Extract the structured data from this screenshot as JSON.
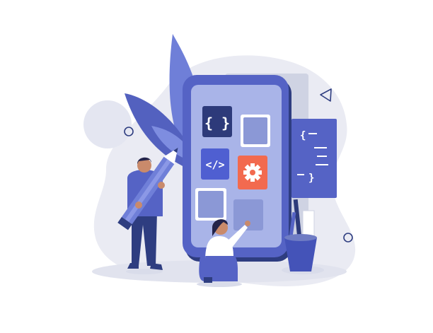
{
  "palette": {
    "blob": "#eaebf3",
    "blob_dark": "#e1e3ee",
    "navy": "#2e3d80",
    "phone_blue": "#5563c5",
    "screen": "#a9b4e8",
    "tile": "#8b98d6",
    "tile_edge": "#6f7cc4",
    "dark_tile": "#2d3a7a",
    "accent_red": "#f26a4f",
    "leaf": "#6f7fd8",
    "leaf_dark": "#5361bf",
    "skin": "#c98a6b",
    "hair": "#23234a"
  },
  "icons": {
    "braces_tile": "curly-braces",
    "code_tile": "code-tag",
    "settings_tile": "gear",
    "doc_card": "code-document"
  },
  "glyphs": {
    "braces": "{ }",
    "code": "</>",
    "doc_open": "{",
    "doc_close": "}",
    "doc_dash_top": "—",
    "doc_dash_bottom": "—"
  }
}
